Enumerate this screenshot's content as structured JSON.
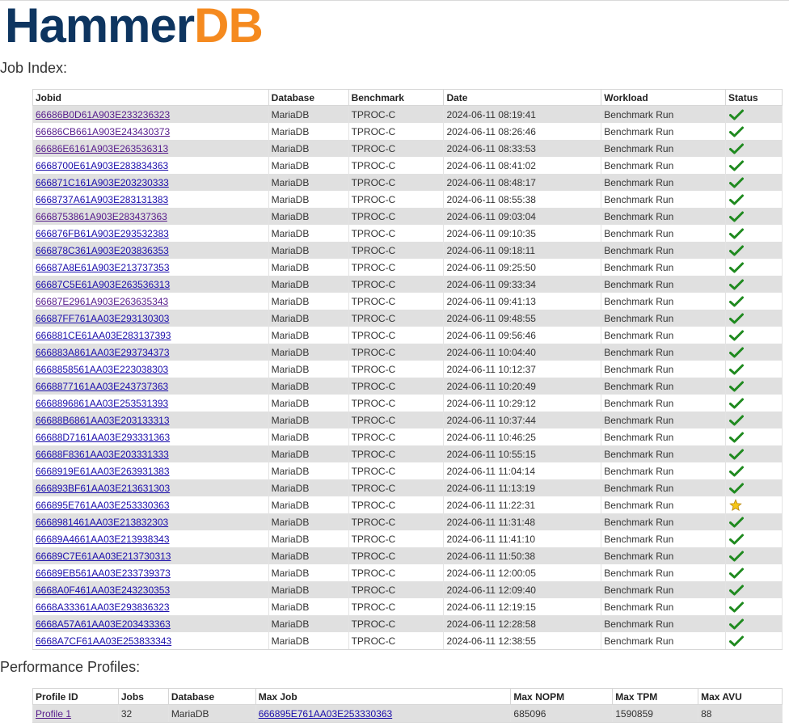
{
  "logo": {
    "part1": "Hammer",
    "part2": "DB"
  },
  "job_index": {
    "title": "Job Index:",
    "headers": [
      "Jobid",
      "Database",
      "Benchmark",
      "Date",
      "Workload",
      "Status"
    ],
    "rows": [
      {
        "jobid": "66686B0D61A903E233236323",
        "database": "MariaDB",
        "benchmark": "TPROC-C",
        "date": "2024-06-11 08:19:41",
        "workload": "Benchmark Run",
        "status": "check",
        "visited": true
      },
      {
        "jobid": "66686CB661A903E243430373",
        "database": "MariaDB",
        "benchmark": "TPROC-C",
        "date": "2024-06-11 08:26:46",
        "workload": "Benchmark Run",
        "status": "check",
        "visited": true
      },
      {
        "jobid": "66686E6161A903E263536313",
        "database": "MariaDB",
        "benchmark": "TPROC-C",
        "date": "2024-06-11 08:33:53",
        "workload": "Benchmark Run",
        "status": "check",
        "visited": true
      },
      {
        "jobid": "6668700E61A903E283834363",
        "database": "MariaDB",
        "benchmark": "TPROC-C",
        "date": "2024-06-11 08:41:02",
        "workload": "Benchmark Run",
        "status": "check",
        "visited": false
      },
      {
        "jobid": "666871C161A903E203230333",
        "database": "MariaDB",
        "benchmark": "TPROC-C",
        "date": "2024-06-11 08:48:17",
        "workload": "Benchmark Run",
        "status": "check",
        "visited": false
      },
      {
        "jobid": "6668737A61A903E283131383",
        "database": "MariaDB",
        "benchmark": "TPROC-C",
        "date": "2024-06-11 08:55:38",
        "workload": "Benchmark Run",
        "status": "check",
        "visited": false
      },
      {
        "jobid": "6668753861A903E283437363",
        "database": "MariaDB",
        "benchmark": "TPROC-C",
        "date": "2024-06-11 09:03:04",
        "workload": "Benchmark Run",
        "status": "check",
        "visited": true
      },
      {
        "jobid": "666876FB61A903E293532383",
        "database": "MariaDB",
        "benchmark": "TPROC-C",
        "date": "2024-06-11 09:10:35",
        "workload": "Benchmark Run",
        "status": "check",
        "visited": false
      },
      {
        "jobid": "666878C361A903E203836353",
        "database": "MariaDB",
        "benchmark": "TPROC-C",
        "date": "2024-06-11 09:18:11",
        "workload": "Benchmark Run",
        "status": "check",
        "visited": false
      },
      {
        "jobid": "66687A8E61A903E213737353",
        "database": "MariaDB",
        "benchmark": "TPROC-C",
        "date": "2024-06-11 09:25:50",
        "workload": "Benchmark Run",
        "status": "check",
        "visited": false
      },
      {
        "jobid": "66687C5E61A903E263536313",
        "database": "MariaDB",
        "benchmark": "TPROC-C",
        "date": "2024-06-11 09:33:34",
        "workload": "Benchmark Run",
        "status": "check",
        "visited": false
      },
      {
        "jobid": "66687E2961A903E263635343",
        "database": "MariaDB",
        "benchmark": "TPROC-C",
        "date": "2024-06-11 09:41:13",
        "workload": "Benchmark Run",
        "status": "check",
        "visited": true
      },
      {
        "jobid": "66687FF761AA03E293130303",
        "database": "MariaDB",
        "benchmark": "TPROC-C",
        "date": "2024-06-11 09:48:55",
        "workload": "Benchmark Run",
        "status": "check",
        "visited": false
      },
      {
        "jobid": "666881CE61AA03E283137393",
        "database": "MariaDB",
        "benchmark": "TPROC-C",
        "date": "2024-06-11 09:56:46",
        "workload": "Benchmark Run",
        "status": "check",
        "visited": false
      },
      {
        "jobid": "666883A861AA03E293734373",
        "database": "MariaDB",
        "benchmark": "TPROC-C",
        "date": "2024-06-11 10:04:40",
        "workload": "Benchmark Run",
        "status": "check",
        "visited": false
      },
      {
        "jobid": "6668858561AA03E223038303",
        "database": "MariaDB",
        "benchmark": "TPROC-C",
        "date": "2024-06-11 10:12:37",
        "workload": "Benchmark Run",
        "status": "check",
        "visited": false
      },
      {
        "jobid": "6668877161AA03E243737363",
        "database": "MariaDB",
        "benchmark": "TPROC-C",
        "date": "2024-06-11 10:20:49",
        "workload": "Benchmark Run",
        "status": "check",
        "visited": false
      },
      {
        "jobid": "6668896861AA03E253531393",
        "database": "MariaDB",
        "benchmark": "TPROC-C",
        "date": "2024-06-11 10:29:12",
        "workload": "Benchmark Run",
        "status": "check",
        "visited": false
      },
      {
        "jobid": "66688B6861AA03E203133313",
        "database": "MariaDB",
        "benchmark": "TPROC-C",
        "date": "2024-06-11 10:37:44",
        "workload": "Benchmark Run",
        "status": "check",
        "visited": false
      },
      {
        "jobid": "66688D7161AA03E293331363",
        "database": "MariaDB",
        "benchmark": "TPROC-C",
        "date": "2024-06-11 10:46:25",
        "workload": "Benchmark Run",
        "status": "check",
        "visited": false
      },
      {
        "jobid": "66688F8361AA03E203331333",
        "database": "MariaDB",
        "benchmark": "TPROC-C",
        "date": "2024-06-11 10:55:15",
        "workload": "Benchmark Run",
        "status": "check",
        "visited": false
      },
      {
        "jobid": "6668919E61AA03E263931383",
        "database": "MariaDB",
        "benchmark": "TPROC-C",
        "date": "2024-06-11 11:04:14",
        "workload": "Benchmark Run",
        "status": "check",
        "visited": false
      },
      {
        "jobid": "666893BF61AA03E213631303",
        "database": "MariaDB",
        "benchmark": "TPROC-C",
        "date": "2024-06-11 11:13:19",
        "workload": "Benchmark Run",
        "status": "check",
        "visited": false
      },
      {
        "jobid": "666895E761AA03E253330363",
        "database": "MariaDB",
        "benchmark": "TPROC-C",
        "date": "2024-06-11 11:22:31",
        "workload": "Benchmark Run",
        "status": "star",
        "visited": false
      },
      {
        "jobid": "6668981461AA03E213832303",
        "database": "MariaDB",
        "benchmark": "TPROC-C",
        "date": "2024-06-11 11:31:48",
        "workload": "Benchmark Run",
        "status": "check",
        "visited": false
      },
      {
        "jobid": "66689A4661AA03E213938343",
        "database": "MariaDB",
        "benchmark": "TPROC-C",
        "date": "2024-06-11 11:41:10",
        "workload": "Benchmark Run",
        "status": "check",
        "visited": false
      },
      {
        "jobid": "66689C7E61AA03E213730313",
        "database": "MariaDB",
        "benchmark": "TPROC-C",
        "date": "2024-06-11 11:50:38",
        "workload": "Benchmark Run",
        "status": "check",
        "visited": false
      },
      {
        "jobid": "66689EB561AA03E233739373",
        "database": "MariaDB",
        "benchmark": "TPROC-C",
        "date": "2024-06-11 12:00:05",
        "workload": "Benchmark Run",
        "status": "check",
        "visited": false
      },
      {
        "jobid": "6668A0F461AA03E243230353",
        "database": "MariaDB",
        "benchmark": "TPROC-C",
        "date": "2024-06-11 12:09:40",
        "workload": "Benchmark Run",
        "status": "check",
        "visited": false
      },
      {
        "jobid": "6668A33361AA03E293836323",
        "database": "MariaDB",
        "benchmark": "TPROC-C",
        "date": "2024-06-11 12:19:15",
        "workload": "Benchmark Run",
        "status": "check",
        "visited": false
      },
      {
        "jobid": "6668A57A61AA03E203433363",
        "database": "MariaDB",
        "benchmark": "TPROC-C",
        "date": "2024-06-11 12:28:58",
        "workload": "Benchmark Run",
        "status": "check",
        "visited": false
      },
      {
        "jobid": "6668A7CF61AA03E253833343",
        "database": "MariaDB",
        "benchmark": "TPROC-C",
        "date": "2024-06-11 12:38:55",
        "workload": "Benchmark Run",
        "status": "check",
        "visited": false
      }
    ]
  },
  "performance_profiles": {
    "title": "Performance Profiles:",
    "headers": [
      "Profile ID",
      "Jobs",
      "Database",
      "Max Job",
      "Max NOPM",
      "Max TPM",
      "Max AVU"
    ],
    "rows": [
      {
        "profile_id": "Profile 1",
        "jobs": "32",
        "database": "MariaDB",
        "max_job": "666895E761AA03E253330363",
        "max_nopm": "685096",
        "max_tpm": "1590859",
        "max_avu": "88"
      }
    ]
  },
  "colors": {
    "logo_blue": "#0e3560",
    "logo_orange": "#f58a1f",
    "link": "#1a0dab",
    "visited_link": "#551a8b",
    "row_stripe": "#e0e0e0",
    "check_green": "#1f8a1f",
    "star_gold": "#f5c518"
  },
  "icons": {
    "check": "check-icon",
    "star": "star-icon"
  }
}
